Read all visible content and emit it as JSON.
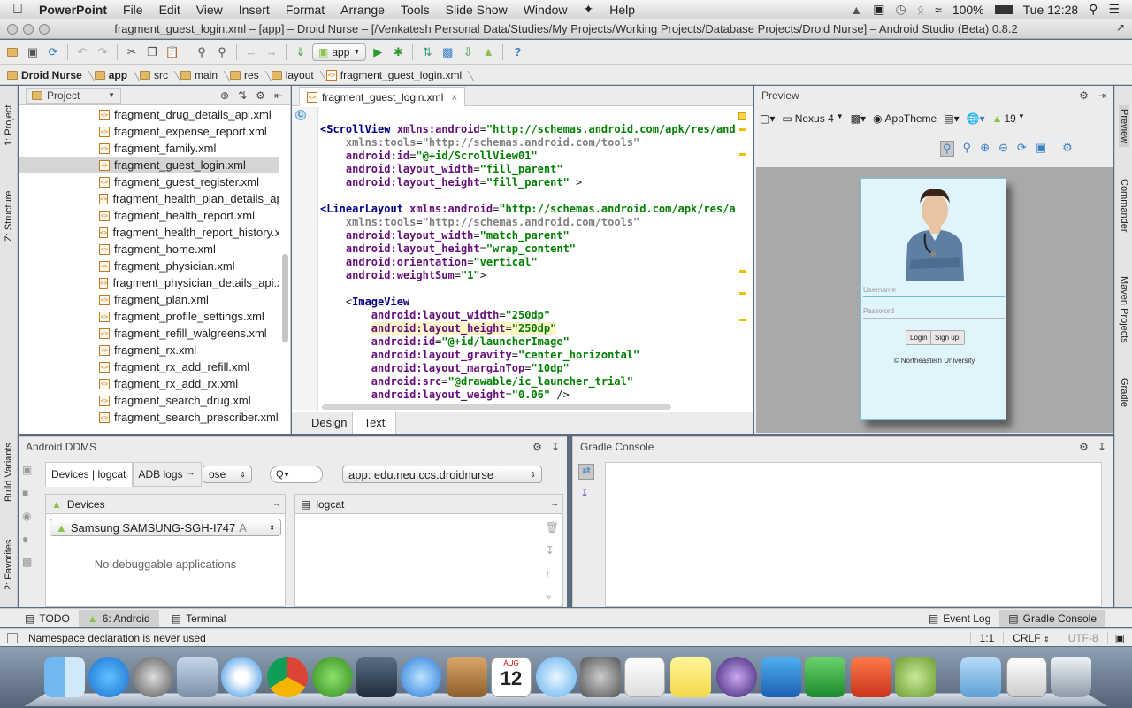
{
  "menubar": {
    "app_name": "PowerPoint",
    "items": [
      "File",
      "Edit",
      "View",
      "Insert",
      "Format",
      "Arrange",
      "Tools",
      "Slide Show",
      "Window",
      "Help"
    ],
    "battery": "100%",
    "clock": "Tue 12:28"
  },
  "window": {
    "title": "fragment_guest_login.xml – [app] – Droid Nurse – [/Venkatesh Personal Data/Studies/My Projects/Working Projects/Database Projects/Droid Nurse] – Android Studio (Beta) 0.8.2"
  },
  "toolbar": {
    "run_config": "app"
  },
  "breadcrumbs": [
    "Droid Nurse",
    "app",
    "src",
    "main",
    "res",
    "layout",
    "fragment_guest_login.xml"
  ],
  "left_stripe": {
    "project_tab": "1: Project",
    "structure_tab": "Z: Structure",
    "build_variants_tab": "Build Variants",
    "favorites_tab": "2: Favorites"
  },
  "right_stripe": {
    "preview_tab": "Preview",
    "commander_tab": "Commander",
    "maven_tab": "Maven Projects",
    "gradle_tab": "Gradle"
  },
  "project_panel": {
    "header": "Project",
    "files": [
      "fragment_drug_details_api.xml",
      "fragment_expense_report.xml",
      "fragment_family.xml",
      "fragment_guest_login.xml",
      "fragment_guest_register.xml",
      "fragment_health_plan_details_ap",
      "fragment_health_report.xml",
      "fragment_health_report_history.x",
      "fragment_home.xml",
      "fragment_physician.xml",
      "fragment_physician_details_api.x",
      "fragment_plan.xml",
      "fragment_profile_settings.xml",
      "fragment_refill_walgreens.xml",
      "fragment_rx.xml",
      "fragment_rx_add_refill.xml",
      "fragment_rx_add_rx.xml",
      "fragment_search_drug.xml",
      "fragment_search_prescriber.xml"
    ],
    "selected_index": 3
  },
  "editor": {
    "tab_label": "fragment_guest_login.xml",
    "bottom_tabs": [
      "Design",
      "Text"
    ],
    "active_bottom_tab": "Text"
  },
  "preview": {
    "header": "Preview",
    "device": "Nexus 4",
    "theme": "AppTheme",
    "api_level": "19",
    "username_placeholder": "Username",
    "password_placeholder": "Password",
    "login_button": "Login",
    "signup_button": "Sign up!",
    "footer": "© Northeastern University"
  },
  "ddms": {
    "header": "Android DDMS",
    "tab_devices": "Devices | logcat",
    "tab_adb": "ADB logs",
    "log_level": "ose",
    "search_icon_label": "Q",
    "app_filter": "app: edu.neu.ccs.droidnurse",
    "devices_label": "Devices",
    "device_selected": "Samsung SAMSUNG-SGH-I747",
    "device_suffix": "A",
    "no_apps": "No debuggable applications",
    "logcat_label": "logcat"
  },
  "gradle_console": {
    "header": "Gradle Console"
  },
  "bottom_tabs": {
    "todo": "TODO",
    "android": "6: Android",
    "terminal": "Terminal",
    "event_log": "Event Log",
    "gradle_console": "Gradle Console"
  },
  "statusbar": {
    "message": "Namespace declaration is never used",
    "position": "1:1",
    "line_separator": "CRLF",
    "encoding": "UTF-8"
  },
  "dock": {
    "calendar_month": "AUG",
    "calendar_day": "12"
  }
}
